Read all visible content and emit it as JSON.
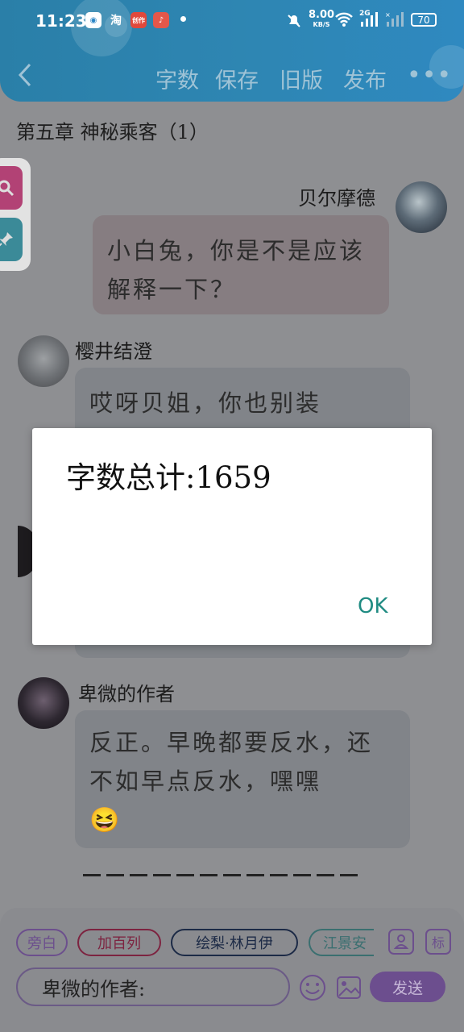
{
  "status_bar": {
    "time": "11:23",
    "app_icons": [
      "淘",
      "创作",
      "♪"
    ],
    "net_speed": "8.00",
    "net_unit": "KB/S",
    "signal_label": "2G",
    "battery": "70"
  },
  "header": {
    "actions": [
      "字数",
      "保存",
      "旧版",
      "发布"
    ],
    "more": "•••",
    "color": "#2e86b3"
  },
  "chapter_title": "第五章  神秘乘客（1）",
  "messages": [
    {
      "name": "贝尔摩德",
      "text": "小白兔，你是不是应该解释一下？",
      "side": "right"
    },
    {
      "name": "樱井结澄",
      "text": "哎呀贝姐，你也别装",
      "side": "left"
    },
    {
      "name": "卑微的作者",
      "text": "反正。早晚都要反水，还不如早点反水，嘿嘿",
      "emoji": "😆",
      "side": "left"
    }
  ],
  "bottom_bar": {
    "chips": [
      "旁白",
      "加百列",
      "绘梨·林月伊",
      "江景安"
    ],
    "icon_user": "person-icon",
    "icon_tag": "标",
    "input_value": "卑微的作者:",
    "send_label": "发送",
    "accent": "#6c4e8e"
  },
  "dialog": {
    "message": "字数总计:1659",
    "ok_label": "OK",
    "ok_color": "#1f8b82"
  }
}
